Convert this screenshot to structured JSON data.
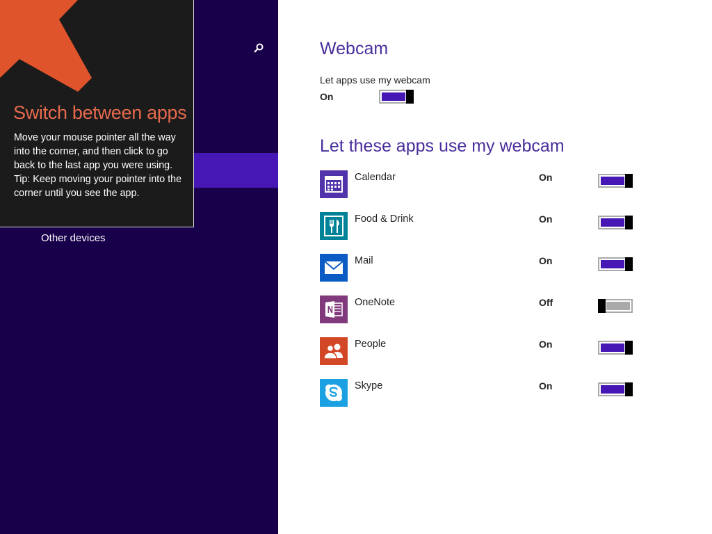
{
  "sidebar": {
    "nav_items": [
      {
        "label": "Other devices"
      }
    ]
  },
  "tooltip": {
    "title": "Switch between apps",
    "body_line1": "Move your mouse pointer all the way into the corner, and then click to go back to the last app you were using.",
    "body_line2": "Tip: Keep moving your pointer into the corner until you see the app."
  },
  "webcam": {
    "title": "Webcam",
    "setting_label": "Let apps use my webcam",
    "setting_state": "On",
    "setting_on": true
  },
  "apps_section": {
    "title": "Let these apps use my webcam",
    "apps": [
      {
        "name": "Calendar",
        "state": "On",
        "on": true,
        "icon": "calendar-icon",
        "color": "#5133ab"
      },
      {
        "name": "Food & Drink",
        "state": "On",
        "on": true,
        "icon": "fork-knife-icon",
        "color": "#008299"
      },
      {
        "name": "Mail",
        "state": "On",
        "on": true,
        "icon": "envelope-icon",
        "color": "#0a5bc4"
      },
      {
        "name": "OneNote",
        "state": "Off",
        "on": false,
        "icon": "onenote-icon",
        "color": "#80397b"
      },
      {
        "name": "People",
        "state": "On",
        "on": true,
        "icon": "people-icon",
        "color": "#d24726"
      },
      {
        "name": "Skype",
        "state": "On",
        "on": true,
        "icon": "skype-icon",
        "color": "#1ba1e2"
      }
    ]
  },
  "colors": {
    "sidebar_bg": "#18004a",
    "accent": "#4617b4",
    "heading": "#4a2e9c",
    "tip_title": "#e56a4d"
  }
}
